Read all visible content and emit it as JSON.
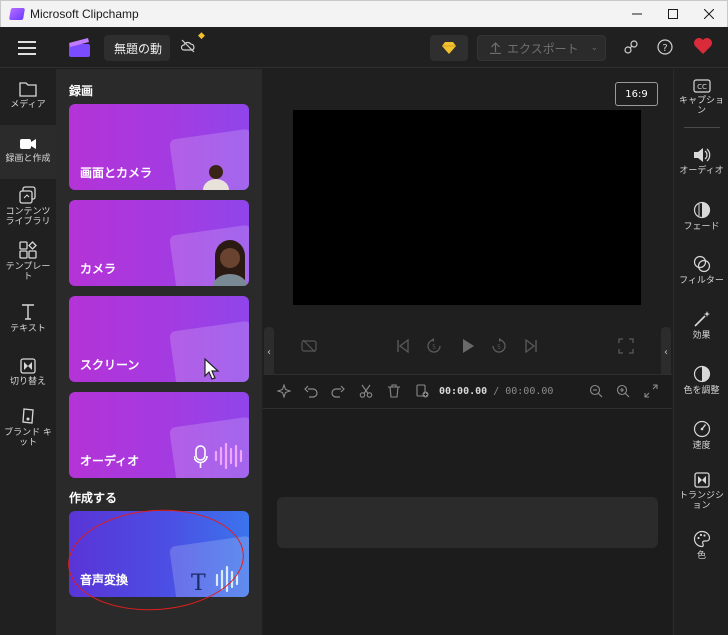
{
  "window": {
    "title": "Microsoft Clipchamp"
  },
  "header": {
    "project_title": "無題の動",
    "export_label": "エクスポート"
  },
  "left_nav": [
    {
      "label": "メディア"
    },
    {
      "label": "録画と作成"
    },
    {
      "label_line1": "コンテンツ",
      "label_line2": "ライブラリ"
    },
    {
      "label_line1": "テンプレー",
      "label_line2": "ト"
    },
    {
      "label": "テキスト"
    },
    {
      "label": "切り替え"
    },
    {
      "label_line1": "ブランド キ",
      "label_line2": "ット"
    }
  ],
  "panel": {
    "record_title": "録画",
    "cards": [
      {
        "label": "画面とカメラ"
      },
      {
        "label": "カメラ"
      },
      {
        "label": "スクリーン"
      },
      {
        "label": "オーディオ"
      }
    ],
    "create_title": "作成する",
    "tts_label": "音声変換"
  },
  "preview": {
    "aspect_ratio": "16:9"
  },
  "timeline": {
    "current_time": "00:00.00",
    "total_time": "/ 00:00.00"
  },
  "right_nav": [
    {
      "label_line1": "キャプショ",
      "label_line2": "ン"
    },
    {
      "label": "オーディオ"
    },
    {
      "label": "フェード"
    },
    {
      "label": "フィルター"
    },
    {
      "label": "効果"
    },
    {
      "label": "色を調整"
    },
    {
      "label": "速度"
    },
    {
      "label_line1": "トランジシ",
      "label_line2": "ョン"
    },
    {
      "label": "色"
    }
  ],
  "colors": {
    "accent_purple": "#a43be1",
    "premium_gold": "#f2c12e",
    "annotation_red": "#e01e1e"
  }
}
